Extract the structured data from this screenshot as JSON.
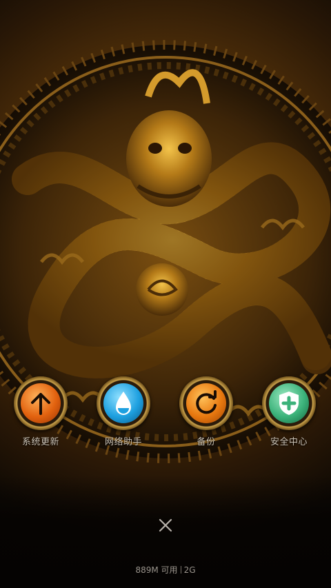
{
  "wallpaper": {
    "subject": "carved golden dragon",
    "accent": "#c9a14a"
  },
  "tiles": [
    {
      "label": "系统更新",
      "icon": "arrow-up-icon",
      "color": "#e2620f"
    },
    {
      "label": "网络助手",
      "icon": "water-drop-icon",
      "color": "#1ea0e0"
    },
    {
      "label": "备份",
      "icon": "refresh-icon",
      "color": "#e8780f"
    },
    {
      "label": "安全中心",
      "icon": "shield-plus-icon",
      "color": "#3bb27a"
    }
  ],
  "close": {
    "icon": "close-icon"
  },
  "status": {
    "memory": "889M 可用",
    "network": "2G"
  }
}
